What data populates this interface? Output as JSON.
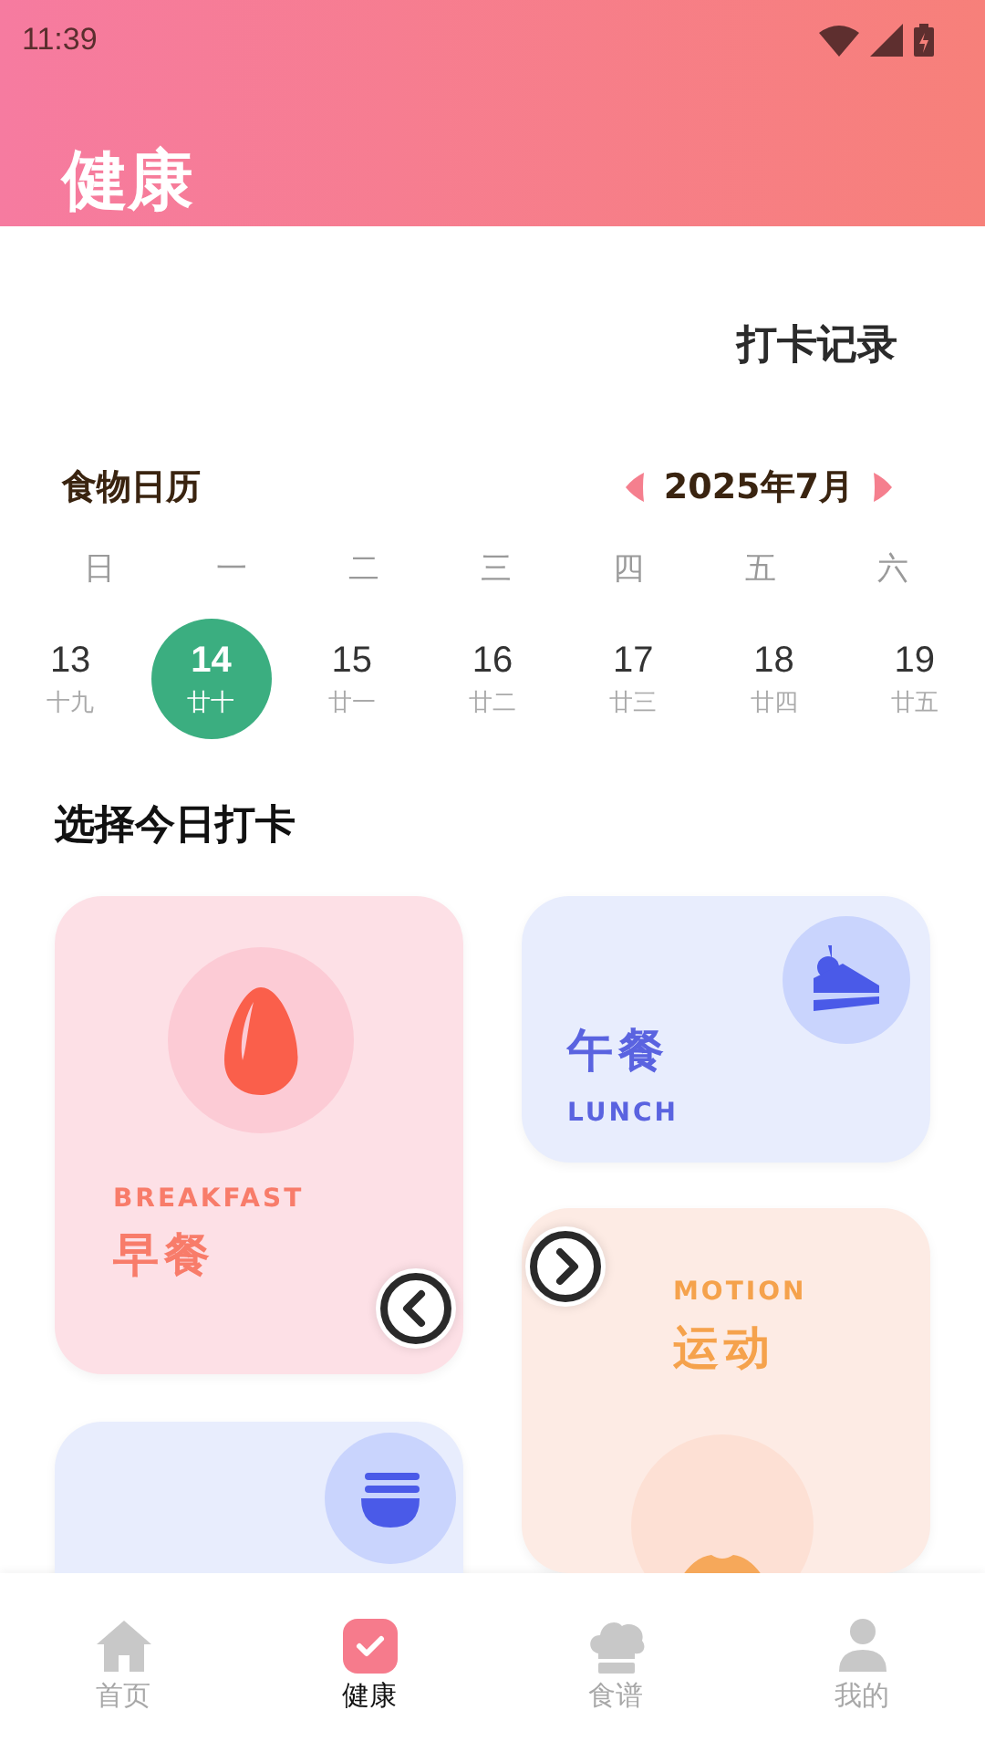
{
  "status_bar": {
    "time": "11:39"
  },
  "header": {
    "title": "健康"
  },
  "record_link": "打卡记录",
  "calendar": {
    "title": "食物日历",
    "month": "2025年7月",
    "weekdays": [
      "日",
      "一",
      "二",
      "三",
      "四",
      "五",
      "六"
    ],
    "days": [
      {
        "day": "13",
        "lunar": "十九",
        "selected": false
      },
      {
        "day": "14",
        "lunar": "廿十",
        "selected": true
      },
      {
        "day": "15",
        "lunar": "廿一",
        "selected": false
      },
      {
        "day": "16",
        "lunar": "廿二",
        "selected": false
      },
      {
        "day": "17",
        "lunar": "廿三",
        "selected": false
      },
      {
        "day": "18",
        "lunar": "廿四",
        "selected": false
      },
      {
        "day": "19",
        "lunar": "廿五",
        "selected": false
      }
    ]
  },
  "section_title": "选择今日打卡",
  "cards": [
    {
      "kind": "breakfast",
      "label_en": "BREAKFAST",
      "label_cn": "早餐"
    },
    {
      "kind": "lunch",
      "label_en": "LUNCH",
      "label_cn": "午餐"
    },
    {
      "kind": "motion",
      "label_en": "MOTION",
      "label_cn": "运动"
    },
    {
      "kind": "dinner"
    }
  ],
  "nav": [
    {
      "kind": "home",
      "label": "首页",
      "selected": false
    },
    {
      "kind": "health",
      "label": "健康",
      "selected": true
    },
    {
      "kind": "recipes",
      "label": "食谱",
      "selected": false
    },
    {
      "kind": "profile",
      "label": "我的",
      "selected": false
    }
  ]
}
